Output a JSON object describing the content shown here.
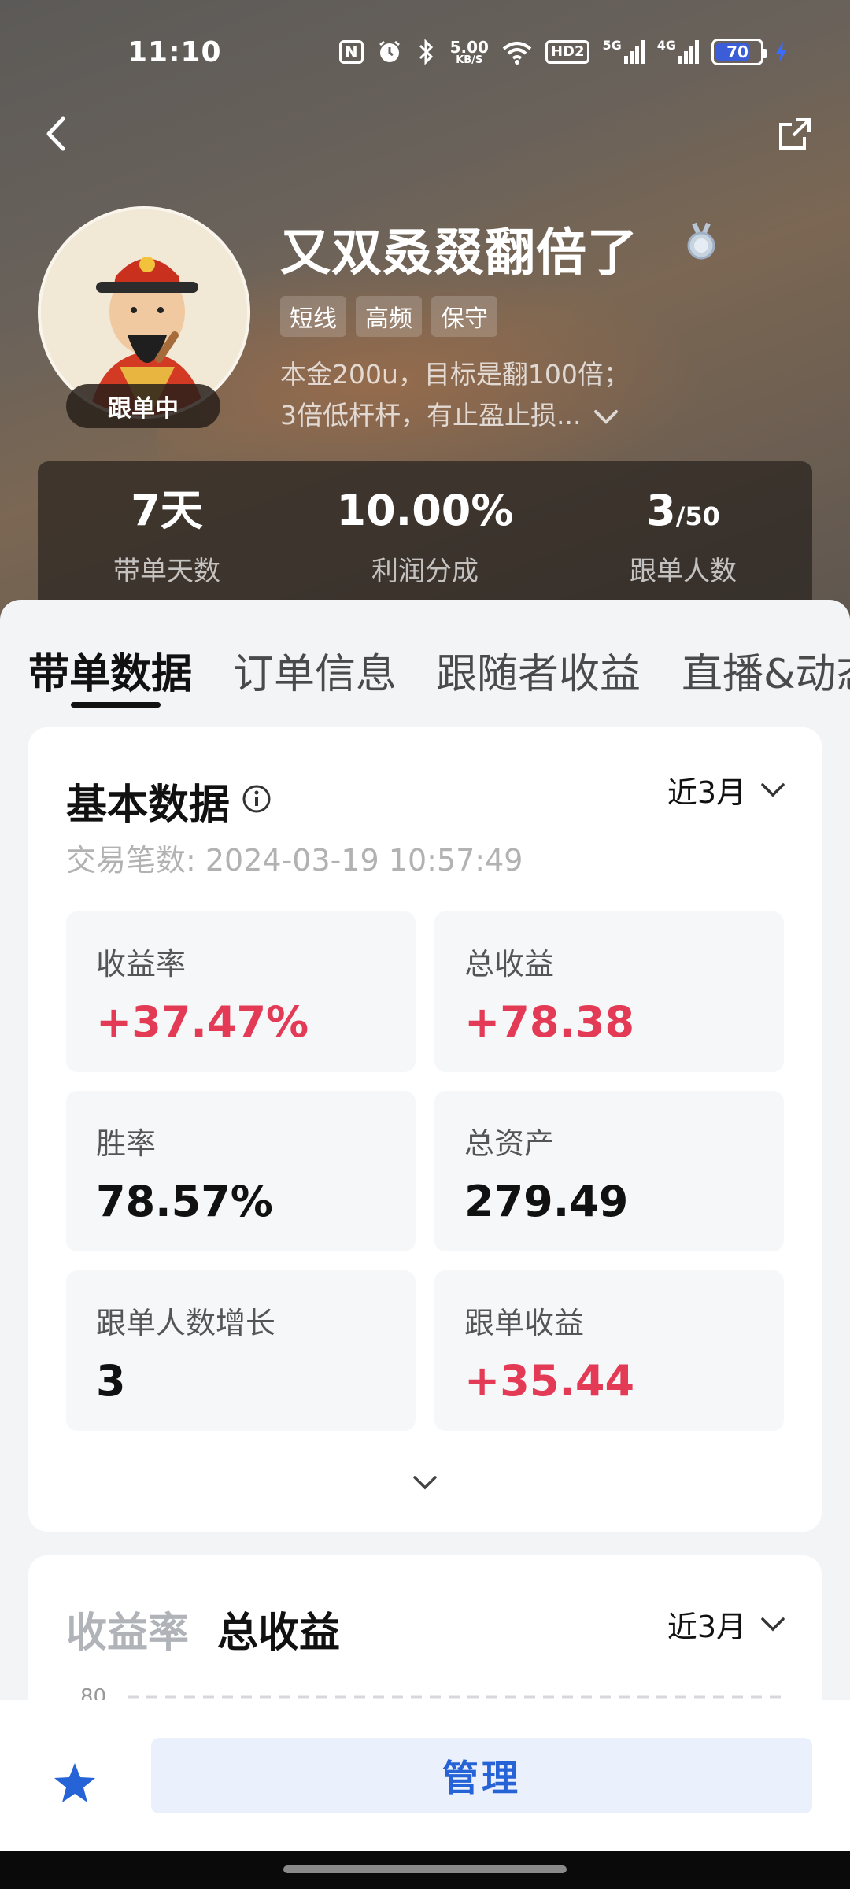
{
  "status_bar": {
    "time": "11:10",
    "net_speed_value": "5.00",
    "net_speed_unit": "KB/S",
    "hd_label": "HD2",
    "signal_5g": "5G",
    "signal_4g": "4G",
    "battery": "70",
    "accent_color": "#3b6cff"
  },
  "nav": {
    "back_icon": "chevron-left-icon",
    "share_icon": "share-icon"
  },
  "profile": {
    "name": "又双叒叕翻倍了",
    "status_badge": "跟单中",
    "medal_icon": "medal-icon",
    "tags": [
      "短线",
      "高频",
      "保守"
    ],
    "bio_line1": "本金200u，目标是翻100倍；",
    "bio_line2": "3倍低杆杆，有止盈止损..."
  },
  "stats": [
    {
      "value": "7天",
      "suffix": "",
      "label": "带单天数"
    },
    {
      "value": "10.00%",
      "suffix": "",
      "label": "利润分成"
    },
    {
      "value": "3",
      "suffix": "/50",
      "label": "跟单人数"
    }
  ],
  "tabs": [
    "带单数据",
    "订单信息",
    "跟随者收益",
    "直播&动态"
  ],
  "basic": {
    "title": "基本数据",
    "period": "近3月",
    "trade_line": "交易笔数: 2024-03-19 10:57:49",
    "metrics": [
      {
        "label": "收益率",
        "value": "+37.47%",
        "positive": true
      },
      {
        "label": "总收益",
        "value": "+78.38",
        "positive": true
      },
      {
        "label": "胜率",
        "value": "78.57%",
        "positive": false
      },
      {
        "label": "总资产",
        "value": "279.49",
        "positive": false
      },
      {
        "label": "跟单人数增长",
        "value": "3",
        "positive": false
      },
      {
        "label": "跟单收益",
        "value": "+35.44",
        "positive": true
      }
    ]
  },
  "chart_card": {
    "tab_inactive": "收益率",
    "tab_active": "总收益",
    "period": "近3月",
    "y_tick": "80"
  },
  "bottom": {
    "manage_label": "管理",
    "fav_icon": "star-icon"
  },
  "colors": {
    "positive": "#e33b55",
    "primary": "#2563d6"
  }
}
